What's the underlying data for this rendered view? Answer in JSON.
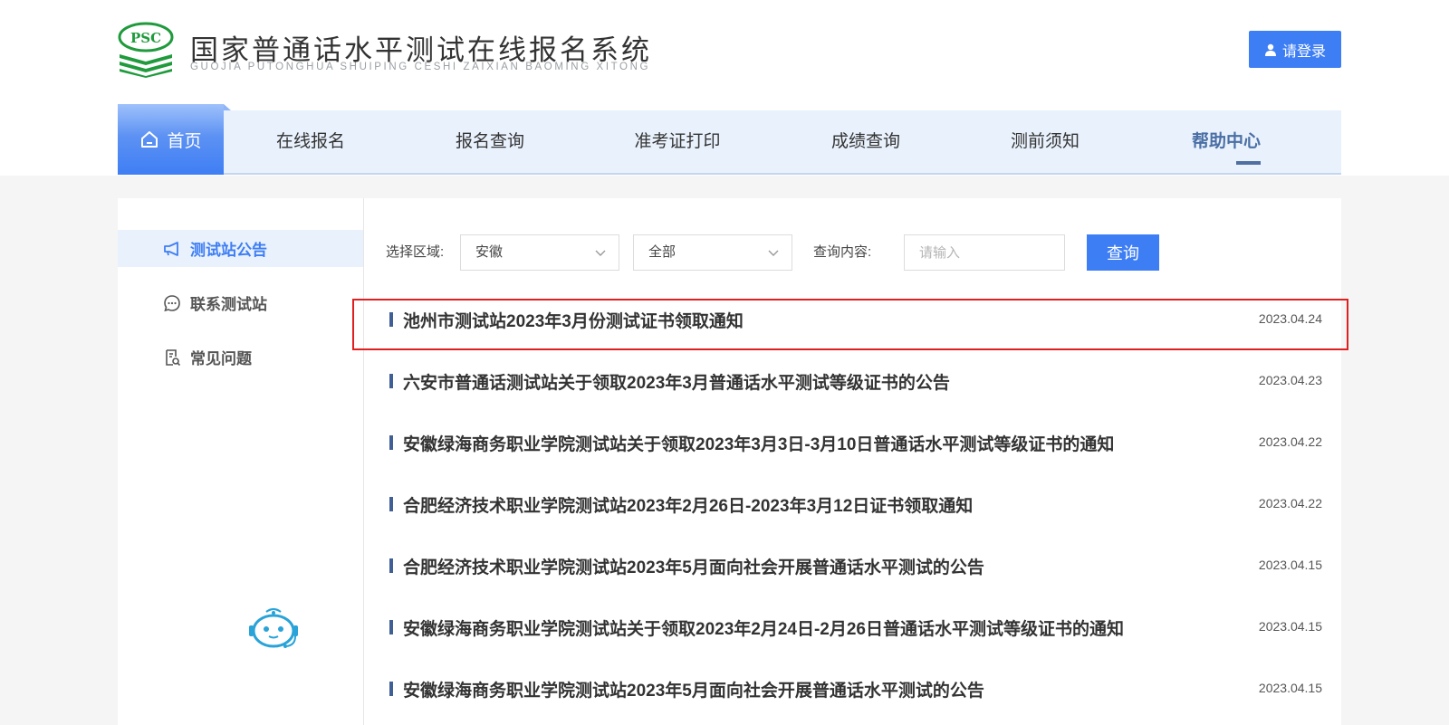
{
  "header": {
    "logo_text": "PSC",
    "title": "国家普通话水平测试在线报名系统",
    "subtitle": "GUOJIA PUTONGHUA SHUIPING CESHI ZAIXIAN BAOMING XITONG",
    "login_label": "请登录"
  },
  "nav": {
    "home": "首页",
    "items": [
      {
        "label": "在线报名"
      },
      {
        "label": "报名查询"
      },
      {
        "label": "准考证打印"
      },
      {
        "label": "成绩查询"
      },
      {
        "label": "测前须知"
      },
      {
        "label": "帮助中心",
        "active": true
      }
    ]
  },
  "sidebar": {
    "items": [
      {
        "label": "测试站公告",
        "icon": "megaphone-icon",
        "active": true
      },
      {
        "label": "联系测试站",
        "icon": "chat-bubble-icon"
      },
      {
        "label": "常见问题",
        "icon": "document-search-icon"
      }
    ],
    "assistant_icon": "robot-assistant-icon"
  },
  "filter": {
    "region_label": "选择区域:",
    "region_value": "安徽",
    "category_value": "全部",
    "query_label": "查询内容:",
    "query_placeholder": "请输入",
    "query_button": "查询"
  },
  "notices": [
    {
      "title": "池州市测试站2023年3月份测试证书领取通知",
      "date": "2023.04.24",
      "highlighted": true
    },
    {
      "title": "六安市普通话测试站关于领取2023年3月普通话水平测试等级证书的公告",
      "date": "2023.04.23"
    },
    {
      "title": "安徽绿海商务职业学院测试站关于领取2023年3月3日-3月10日普通话水平测试等级证书的通知",
      "date": "2023.04.22"
    },
    {
      "title": "合肥经济技术职业学院测试站2023年2月26日-2023年3月12日证书领取通知",
      "date": "2023.04.22"
    },
    {
      "title": "合肥经济技术职业学院测试站2023年5月面向社会开展普通话水平测试的公告",
      "date": "2023.04.15"
    },
    {
      "title": "安徽绿海商务职业学院测试站关于领取2023年2月24日-2月26日普通话水平测试等级证书的通知",
      "date": "2023.04.15"
    },
    {
      "title": "安徽绿海商务职业学院测试站2023年5月面向社会开展普通话水平测试的公告",
      "date": "2023.04.15"
    }
  ],
  "colors": {
    "accent": "#3e7ef4",
    "nav_bg": "#e9f1fc",
    "highlight_border": "#e02020",
    "logo_green": "#1f9a3c"
  }
}
